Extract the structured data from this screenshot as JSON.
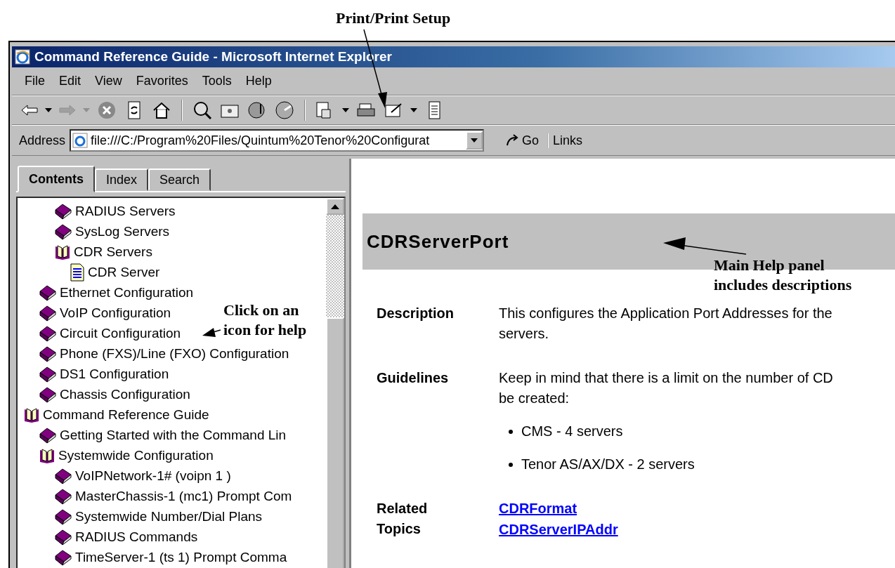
{
  "window": {
    "title": "Command Reference Guide - Microsoft Internet Explorer"
  },
  "menu": [
    "File",
    "Edit",
    "View",
    "Favorites",
    "Tools",
    "Help"
  ],
  "navigation": {
    "back_disabled": false,
    "forward_disabled": true
  },
  "address": {
    "label": "Address",
    "value": "file:///C:/Program%20Files/Quintum%20Tenor%20Configurat",
    "go": "Go",
    "links": "Links"
  },
  "tabs": [
    {
      "label": "Contents",
      "selected": true
    },
    {
      "label": "Index",
      "selected": false
    },
    {
      "label": "Search",
      "selected": false
    }
  ],
  "tree": {
    "items": [
      {
        "kind": "hidden",
        "children": [
          {
            "kind": "hidden",
            "children": [
              {
                "kind": "book",
                "label": "RADIUS Servers",
                "expanded": false
              },
              {
                "kind": "book",
                "label": "SysLog Servers",
                "expanded": false
              },
              {
                "kind": "book",
                "label": "CDR Servers",
                "expanded": true,
                "children": [
                  {
                    "kind": "page",
                    "label": "CDR Server"
                  }
                ]
              }
            ]
          },
          {
            "kind": "book",
            "label": "Ethernet Configuration",
            "expanded": false
          },
          {
            "kind": "book",
            "label": "VoIP Configuration",
            "expanded": false
          },
          {
            "kind": "book",
            "label": "Circuit Configuration",
            "expanded": false
          },
          {
            "kind": "book",
            "label": "Phone (FXS)/Line (FXO) Configuration",
            "expanded": false
          },
          {
            "kind": "book",
            "label": "DS1 Configuration",
            "expanded": false
          },
          {
            "kind": "book",
            "label": "Chassis Configuration",
            "expanded": false
          }
        ]
      },
      {
        "kind": "book",
        "label": "Command Reference Guide",
        "expanded": true,
        "children": [
          {
            "kind": "book",
            "label": "Getting Started with the Command Lin",
            "expanded": false
          },
          {
            "kind": "book",
            "label": "Systemwide Configuration",
            "expanded": true,
            "children": [
              {
                "kind": "book",
                "label": "VoIPNetwork-1# (voipn 1 )",
                "expanded": false
              },
              {
                "kind": "book",
                "label": "MasterChassis-1 (mc1) Prompt Com",
                "expanded": false
              },
              {
                "kind": "book",
                "label": "Systemwide Number/Dial Plans",
                "expanded": false
              },
              {
                "kind": "book",
                "label": "RADIUS Commands",
                "expanded": false
              },
              {
                "kind": "book",
                "label": "TimeServer-1 (ts 1) Prompt Comma",
                "expanded": false
              }
            ]
          }
        ]
      }
    ]
  },
  "topic": {
    "title": "CDRServerPort",
    "sections": [
      {
        "kind": "text",
        "label": "Description",
        "lines": [
          "This configures the Application Port Addresses for the",
          "servers."
        ]
      },
      {
        "kind": "text",
        "label": "Guidelines",
        "lines": [
          "Keep in mind that there is a limit on the number of CD",
          "be created:"
        ],
        "bullets": [
          "CMS - 4 servers",
          "Tenor AS/AX/DX - 2 servers"
        ]
      },
      {
        "kind": "links",
        "label": "Related Topics",
        "links": [
          "CDRFormat",
          "CDRServerIPAddr"
        ]
      }
    ]
  },
  "annotations": [
    {
      "kind": "print",
      "text": "Print/Print Setup"
    },
    {
      "kind": "panel",
      "text": "Main Help panel includes descriptions"
    },
    {
      "kind": "icon",
      "text": "Click on an icon for help"
    }
  ]
}
